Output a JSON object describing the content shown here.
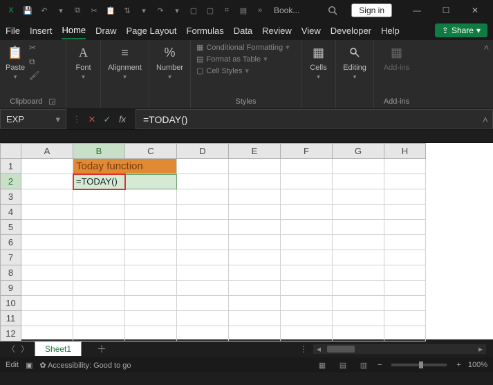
{
  "titlebar": {
    "book_title": "Book...",
    "signin": "Sign in"
  },
  "tabs": {
    "file": "File",
    "insert": "Insert",
    "home": "Home",
    "draw": "Draw",
    "page_layout": "Page Layout",
    "formulas": "Formulas",
    "data": "Data",
    "review": "Review",
    "view": "View",
    "developer": "Developer",
    "help": "Help",
    "share": "Share"
  },
  "ribbon": {
    "clipboard": {
      "paste": "Paste",
      "label": "Clipboard"
    },
    "font": {
      "label": "Font",
      "btn": "Font"
    },
    "alignment": {
      "label": "Alignment",
      "btn": "Alignment"
    },
    "number": {
      "label": "Number",
      "btn": "Number"
    },
    "styles": {
      "label": "Styles",
      "cond": "Conditional Formatting",
      "table": "Format as Table",
      "cell": "Cell Styles"
    },
    "cells": {
      "btn": "Cells"
    },
    "editing": {
      "btn": "Editing"
    },
    "addins": {
      "btn": "Add-ins",
      "label": "Add-ins"
    }
  },
  "fx": {
    "namebox": "EXP",
    "formula": "=TODAY()"
  },
  "sheet": {
    "cols": [
      "A",
      "B",
      "C",
      "D",
      "E",
      "F",
      "G",
      "H"
    ],
    "rows": [
      "1",
      "2",
      "3",
      "4",
      "5",
      "6",
      "7",
      "8",
      "9",
      "10",
      "11",
      "12"
    ],
    "b1": "Today function",
    "b2": "=TODAY()",
    "tab": "Sheet1"
  },
  "status": {
    "mode": "Edit",
    "acc": "Accessibility: Good to go",
    "zoom": "100%"
  }
}
